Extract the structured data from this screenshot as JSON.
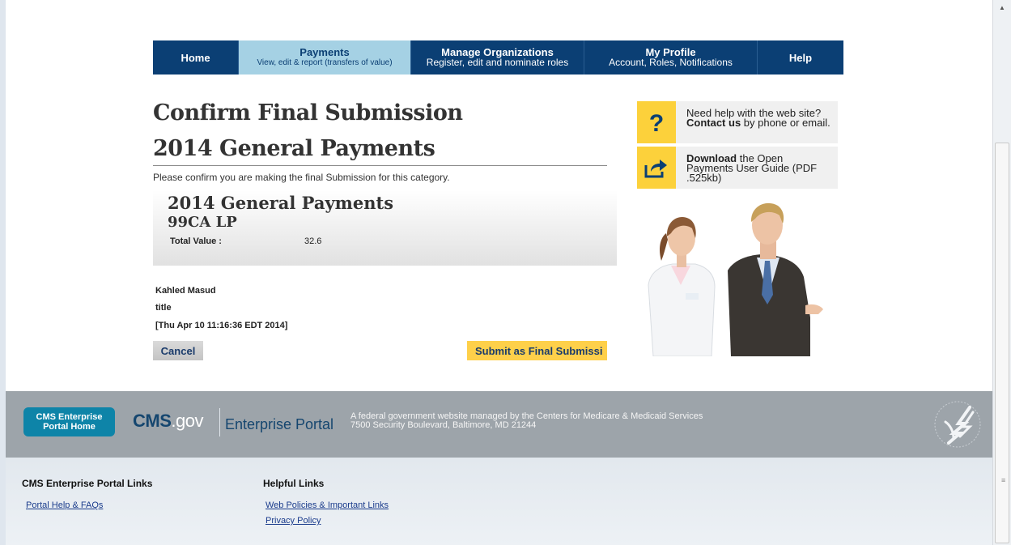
{
  "nav": [
    {
      "title": "Home",
      "subtitle": ""
    },
    {
      "title": "Payments",
      "subtitle": "View, edit & report (transfers of value)"
    },
    {
      "title": "Manage Organizations",
      "subtitle": "Register, edit and nominate roles"
    },
    {
      "title": "My Profile",
      "subtitle": "Account, Roles, Notifications"
    },
    {
      "title": "Help",
      "subtitle": ""
    }
  ],
  "page": {
    "title": "Confirm Final Submission",
    "subtitle": "2014 General Payments",
    "instruction": "Please confirm you are making the final Submission for this category."
  },
  "summary": {
    "title": "2014 General Payments",
    "organization": "99CA LP",
    "total_label": "Total Value :",
    "total_value": "32.6"
  },
  "signer": {
    "name": "Kahled Masud",
    "title": "title",
    "timestamp": "[Thu Apr 10 11:16:36 EDT 2014]"
  },
  "buttons": {
    "cancel": "Cancel",
    "submit": "Submit as Final Submissi"
  },
  "help": {
    "contact_pre": "Need help with the web site? ",
    "contact_bold": "Contact us",
    "contact_post": " by phone or email.",
    "download_bold": "Download",
    "download_post": " the Open Payments User Guide (PDF .525kb)"
  },
  "footer": {
    "portal_button": "CMS Enterprise Portal Home",
    "logo_cms": "CMS",
    "logo_gov": ".gov",
    "logo_sub": "Enterprise Portal",
    "line1": "A federal government website managed by the Centers for Medicare & Medicaid Services",
    "line2": "7500 Security Boulevard, Baltimore, MD 21244"
  },
  "links": {
    "portal_heading": "CMS Enterprise Portal Links",
    "portal_items": [
      "Portal Help & FAQs"
    ],
    "helpful_heading": "Helpful Links",
    "helpful_items": [
      "Web Policies & Important Links",
      "Privacy Policy"
    ]
  },
  "colors": {
    "nav_bg": "#0b3f74",
    "nav_active_bg": "#a5d1e4",
    "submit_bg": "#fed04a",
    "footer_bg": "#9da4aa",
    "portal_button_bg": "#0e84a8"
  },
  "icons": [
    "question-icon",
    "share-arrow-icon",
    "hhs-eagle-icon"
  ]
}
